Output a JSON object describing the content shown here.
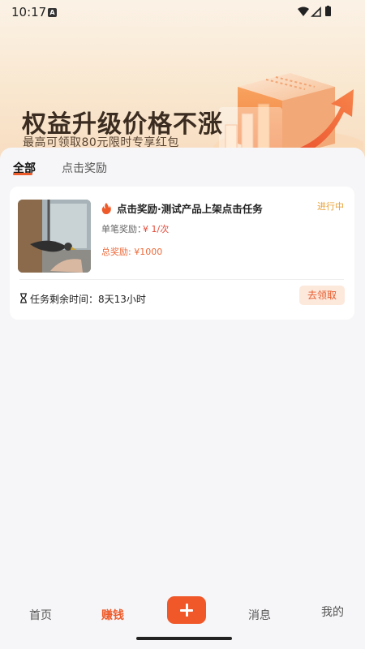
{
  "status_bar": {
    "time": "10:17",
    "notification_icon": "A"
  },
  "banner": {
    "title": "权益升级价格不涨",
    "subtitle": "最高可领取80元限时专享红包"
  },
  "tabs": [
    {
      "label": "全部",
      "active": true
    },
    {
      "label": "点击奖励",
      "active": false
    }
  ],
  "task": {
    "title": "点击奖励·测试产品上架点击任务",
    "status": "进行中",
    "unit_reward_label": "单笔奖励：",
    "unit_reward_value": "¥ 1/次",
    "total_reward": "总奖励: ¥1000",
    "remaining_label": "任务剩余时间：",
    "remaining_value": "8天13小时",
    "claim_label": "去领取",
    "icon": "fire-icon"
  },
  "bottom_nav": [
    {
      "label": "首页",
      "active": false
    },
    {
      "label": "赚钱",
      "active": true
    },
    {
      "label": "+",
      "active": false
    },
    {
      "label": "消息",
      "active": false
    },
    {
      "label": "我的",
      "active": false
    }
  ],
  "colors": {
    "accent": "#f0582a",
    "status_orange": "#e8a135",
    "reward_red": "#e54b3a",
    "banner_bg": "#f9e7cf"
  }
}
